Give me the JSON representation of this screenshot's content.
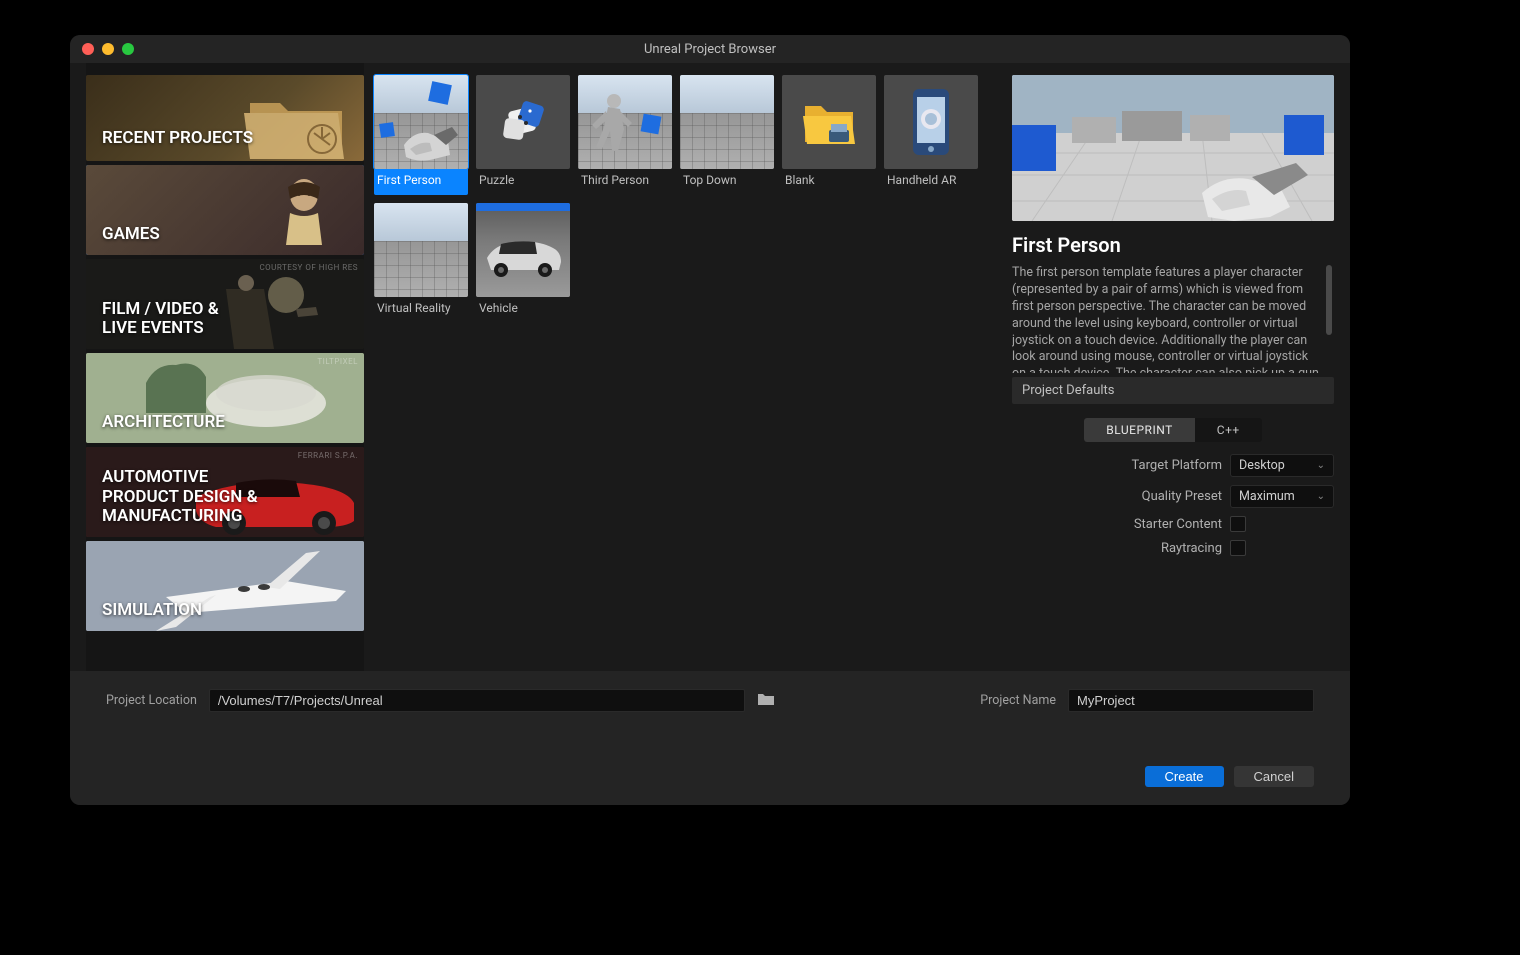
{
  "window": {
    "title": "Unreal Project Browser"
  },
  "categories": [
    {
      "id": "recent",
      "label": "RECENT PROJECTS"
    },
    {
      "id": "games",
      "label": "GAMES",
      "selected": true
    },
    {
      "id": "film",
      "label": "FILM / VIDEO &\nLIVE EVENTS",
      "watermark": "COURTESY OF HIGH RES"
    },
    {
      "id": "architecture",
      "label": "ARCHITECTURE",
      "watermark": "TILTPIXEL"
    },
    {
      "id": "automotive",
      "label": "AUTOMOTIVE\nPRODUCT DESIGN &\nMANUFACTURING",
      "watermark": "FERRARI S.P.A."
    },
    {
      "id": "simulation",
      "label": "SIMULATION"
    }
  ],
  "templates": [
    {
      "id": "first-person",
      "label": "First Person",
      "selected": true
    },
    {
      "id": "puzzle",
      "label": "Puzzle"
    },
    {
      "id": "third-person",
      "label": "Third Person"
    },
    {
      "id": "top-down",
      "label": "Top Down"
    },
    {
      "id": "blank",
      "label": "Blank"
    },
    {
      "id": "handheld-ar",
      "label": "Handheld AR"
    },
    {
      "id": "virtual-reality",
      "label": "Virtual Reality"
    },
    {
      "id": "vehicle",
      "label": "Vehicle"
    }
  ],
  "detail": {
    "title": "First Person",
    "description": "The first person template features a player character (represented by a pair of arms) which is viewed from first person perspective. The character can be moved around the level using keyboard, controller or virtual joystick on a touch device. Additionally the player can look around using mouse, controller or virtual joystick on a touch device. The character can also pick up a gun that, using mouse, controller or virtual joystick on a touch device will fire a simple sphere projectile",
    "defaults_header": "Project Defaults",
    "code_toggle": {
      "options": [
        "BLUEPRINT",
        "C++"
      ],
      "selected": "BLUEPRINT"
    },
    "settings": {
      "target_platform": {
        "label": "Target Platform",
        "value": "Desktop"
      },
      "quality_preset": {
        "label": "Quality Preset",
        "value": "Maximum"
      },
      "starter_content": {
        "label": "Starter Content",
        "checked": false
      },
      "raytracing": {
        "label": "Raytracing",
        "checked": false
      }
    }
  },
  "footer": {
    "location_label": "Project Location",
    "location_value": "/Volumes/T7/Projects/Unreal",
    "name_label": "Project Name",
    "name_value": "MyProject",
    "create": "Create",
    "cancel": "Cancel"
  }
}
